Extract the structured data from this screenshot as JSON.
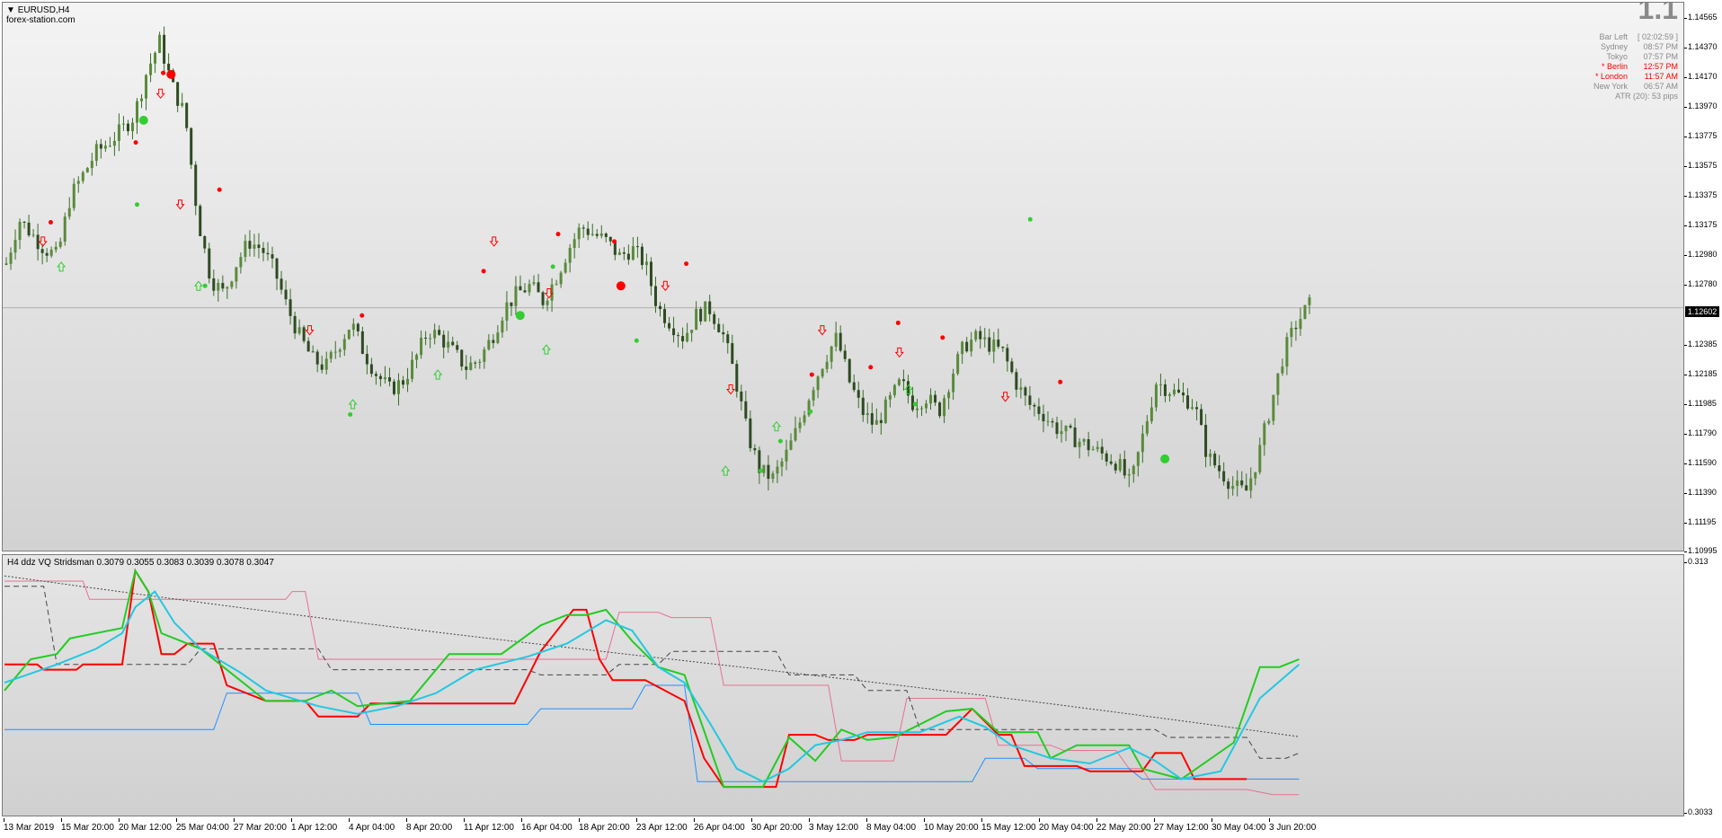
{
  "window": {
    "symbol_title": "EURUSD,H4",
    "site": "forex-station.com"
  },
  "info_panel": {
    "big_value": "1.1",
    "rows": [
      {
        "label": "Bar Left",
        "value": "[ 02:02:59 ]",
        "color": "#8a8a8a"
      },
      {
        "label": "Sydney",
        "value": "08:57 PM",
        "color": "#8a8a8a"
      },
      {
        "label": "Tokyo",
        "value": "07:57 PM",
        "color": "#8a8a8a"
      },
      {
        "label": "* Berlin",
        "value": "12:57 PM",
        "color": "#ff0000"
      },
      {
        "label": "* London",
        "value": "11:57 AM",
        "color": "#ff0000"
      },
      {
        "label": "New York",
        "value": "06:57 AM",
        "color": "#8a8a8a"
      }
    ],
    "atr_text": "ATR (20): 53 pips"
  },
  "price_axis": {
    "labels": [
      "1.14565",
      "1.14370",
      "1.14170",
      "1.13970",
      "1.13775",
      "1.13575",
      "1.13375",
      "1.13175",
      "1.12980",
      "1.12780",
      "1.12385",
      "1.12185",
      "1.11985",
      "1.11790",
      "1.11590",
      "1.11390",
      "1.11195",
      "1.10995"
    ],
    "current_price": "1.12602",
    "ymax": 1.14665,
    "ymin": 1.1096
  },
  "indicator": {
    "title": "H4 ddz VQ Stridsman 0.3079 0.3055 0.3083 0.3039 0.3078 0.3047",
    "axis_top": "0.313",
    "axis_bottom": "0.3033"
  },
  "time_axis": {
    "labels": [
      "13 Mar 2019",
      "15 Mar 20:00",
      "20 Mar 12:00",
      "25 Mar 04:00",
      "27 Mar 20:00",
      "1 Apr 12:00",
      "4 Apr 04:00",
      "8 Apr 20:00",
      "11 Apr 12:00",
      "16 Apr 04:00",
      "18 Apr 20:00",
      "23 Apr 12:00",
      "26 Apr 04:00",
      "30 Apr 20:00",
      "3 May 12:00",
      "8 May 04:00",
      "10 May 20:00",
      "15 May 12:00",
      "20 May 04:00",
      "22 May 20:00",
      "27 May 12:00",
      "30 May 04:00",
      "3 Jun 20:00"
    ]
  },
  "colors": {
    "background_top": "#f2f2f2",
    "background_bottom": "#d4d4d4",
    "candle": "#3a6e2a",
    "candle_body_up": "#5a8a3a",
    "sell_signal": "#ff0000",
    "buy_signal": "#32cd32",
    "ind_red": "#ff0000",
    "ind_green": "#22cc22",
    "ind_cyan": "#22c8e0",
    "ind_blue": "#1e90ff",
    "ind_pink": "#e87090",
    "ind_dash": "#444444"
  },
  "chart_data": {
    "type": "candlestick",
    "close_series": [
      1.129,
      1.132,
      1.131,
      1.13,
      1.1295,
      1.1335,
      1.135,
      1.1365,
      1.1372,
      1.138,
      1.139,
      1.142,
      1.144,
      1.141,
      1.139,
      1.132,
      1.128,
      1.127,
      1.129,
      1.1305,
      1.13,
      1.1285,
      1.126,
      1.124,
      1.1225,
      1.122,
      1.1235,
      1.125,
      1.123,
      1.1215,
      1.1205,
      1.121,
      1.1225,
      1.1245,
      1.124,
      1.123,
      1.122,
      1.1225,
      1.124,
      1.126,
      1.127,
      1.1275,
      1.1265,
      1.128,
      1.13,
      1.1315,
      1.131,
      1.1305,
      1.1295,
      1.13,
      1.129,
      1.126,
      1.125,
      1.124,
      1.1255,
      1.126,
      1.1245,
      1.1215,
      1.1175,
      1.115,
      1.1145,
      1.116,
      1.118,
      1.1205,
      1.1225,
      1.124,
      1.121,
      1.119,
      1.118,
      1.1195,
      1.121,
      1.1195,
      1.12,
      1.119,
      1.1215,
      1.1235,
      1.124,
      1.1235,
      1.123,
      1.121,
      1.1195,
      1.119,
      1.118,
      1.1175,
      1.117,
      1.1165,
      1.116,
      1.1155,
      1.114,
      1.1175,
      1.121,
      1.1205,
      1.12,
      1.1195,
      1.116,
      1.115,
      1.114,
      1.1135,
      1.116,
      1.1195,
      1.123,
      1.125,
      1.1262
    ],
    "sell_arrows": [
      [
        0.028,
        1.1305
      ],
      [
        0.118,
        1.1405
      ],
      [
        0.133,
        1.133
      ],
      [
        0.232,
        1.1245
      ],
      [
        0.373,
        1.1305
      ],
      [
        0.415,
        1.127
      ],
      [
        0.504,
        1.1275
      ],
      [
        0.554,
        1.1205
      ],
      [
        0.624,
        1.1245
      ],
      [
        0.683,
        1.123
      ],
      [
        0.764,
        1.12
      ]
    ],
    "buy_arrows": [
      [
        0.042,
        1.1288
      ],
      [
        0.147,
        1.1275
      ],
      [
        0.265,
        1.1195
      ],
      [
        0.33,
        1.1215
      ],
      [
        0.413,
        1.1232
      ],
      [
        0.55,
        1.115
      ],
      [
        0.589,
        1.118
      ],
      [
        0.69,
        1.1205
      ]
    ],
    "sell_dots": [
      [
        0.034,
        1.1318
      ],
      [
        0.099,
        1.1372
      ],
      [
        0.12,
        1.1419
      ],
      [
        0.163,
        1.134
      ],
      [
        0.272,
        1.1255
      ],
      [
        0.365,
        1.1285
      ],
      [
        0.422,
        1.131
      ],
      [
        0.465,
        1.1305
      ],
      [
        0.52,
        1.129
      ],
      [
        0.616,
        1.1215
      ],
      [
        0.661,
        1.122
      ],
      [
        0.682,
        1.125
      ],
      [
        0.716,
        1.124
      ],
      [
        0.806,
        1.121
      ]
    ],
    "sell_dots_big": [
      [
        0.126,
        1.1418
      ],
      [
        0.47,
        1.1275
      ]
    ],
    "buy_dots": [
      [
        0.1,
        1.133
      ],
      [
        0.152,
        1.1275
      ],
      [
        0.263,
        1.1188
      ],
      [
        0.418,
        1.1288
      ],
      [
        0.482,
        1.1238
      ],
      [
        0.577,
        1.115
      ],
      [
        0.592,
        1.117
      ],
      [
        0.615,
        1.119
      ],
      [
        0.695,
        1.1195
      ],
      [
        0.783,
        1.132
      ]
    ],
    "buy_dots_big": [
      [
        0.105,
        1.1387
      ],
      [
        0.393,
        1.1255
      ],
      [
        0.886,
        1.1158
      ]
    ]
  }
}
